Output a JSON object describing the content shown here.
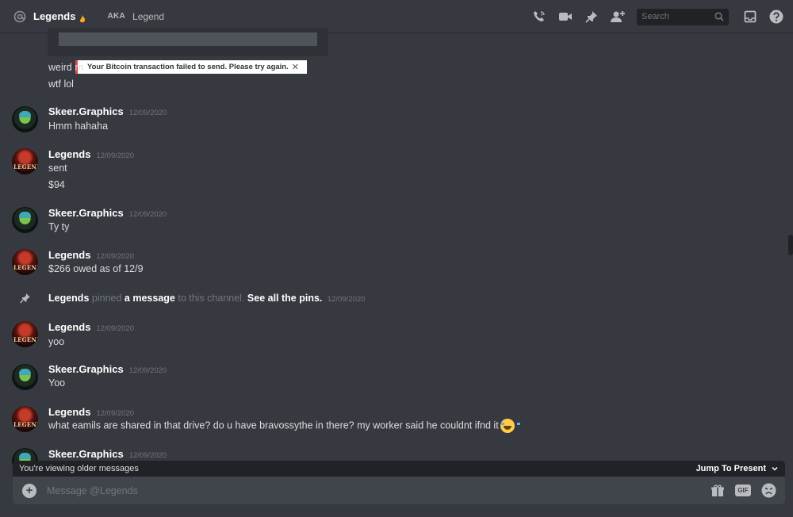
{
  "header": {
    "channel_name": "Legends",
    "aka_label": "AKA",
    "aka_name": "Legend",
    "search_placeholder": "Search"
  },
  "toast": {
    "text": "Your Bitcoin transaction failed to send. Please try again.",
    "close": "✕"
  },
  "continued_messages": [
    "weird rn",
    "wtf lol"
  ],
  "messages": [
    {
      "author": "Skeer.Graphics",
      "avatar": "skeer",
      "timestamp": "12/09/2020",
      "lines": [
        "Hmm hahaha"
      ]
    },
    {
      "author": "Legends",
      "avatar": "legend",
      "timestamp": "12/09/2020",
      "lines": [
        "sent",
        "$94"
      ]
    },
    {
      "author": "Skeer.Graphics",
      "avatar": "skeer",
      "timestamp": "12/09/2020",
      "lines": [
        "Ty ty"
      ]
    },
    {
      "author": "Legends",
      "avatar": "legend",
      "timestamp": "12/09/2020",
      "lines": [
        "$266 owed as of 12/9"
      ]
    },
    {
      "author": "Legends",
      "avatar": "legend",
      "timestamp": "12/09/2020",
      "lines": [
        "yoo"
      ]
    },
    {
      "author": "Skeer.Graphics",
      "avatar": "skeer",
      "timestamp": "12/09/2020",
      "lines": [
        "Yoo"
      ]
    },
    {
      "author": "Legends",
      "avatar": "legend",
      "timestamp": "12/09/2020",
      "lines": [
        "what eamils are shared in that drive? do u have bravossythe in there? my worker said he couldnt ifnd it"
      ]
    },
    {
      "author": "Skeer.Graphics",
      "avatar": "skeer",
      "timestamp": "12/09/2020",
      "lines": []
    }
  ],
  "avatar_text": {
    "legend": "LEGEND"
  },
  "system_message": {
    "actor": "Legends",
    "verb": "pinned",
    "object": "a message",
    "mid": "to this channel.",
    "link": "See all the pins.",
    "timestamp": "12/09/2020"
  },
  "older_bar": {
    "text": "You're viewing older messages",
    "jump": "Jump To Present"
  },
  "composer": {
    "placeholder": "Message @Legends",
    "gif_label": "GIF"
  },
  "colors": {
    "background": "#36393f",
    "error_accent": "#e54646",
    "emoji": "#ffcc4d"
  }
}
